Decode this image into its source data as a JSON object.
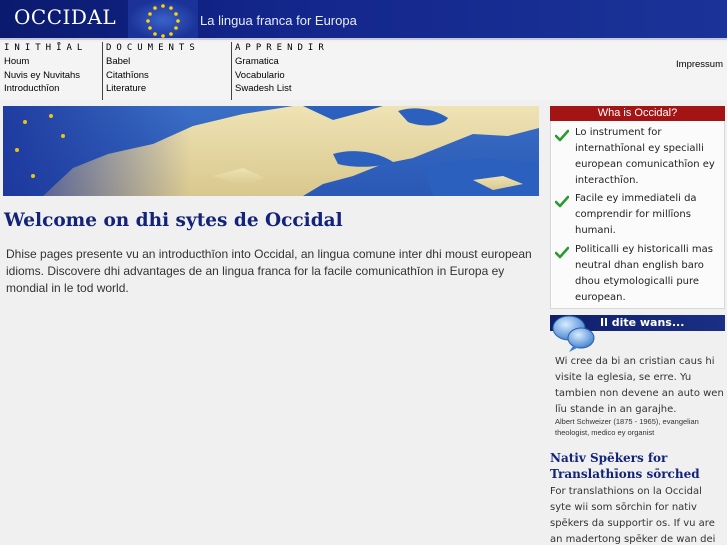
{
  "header": {
    "logo": "OCCIDAL",
    "tagline": "La lingua franca for Europa"
  },
  "nav": {
    "columns": [
      {
        "heading": "INITHĪAL",
        "links": [
          "Houm",
          "Nuvis ey Nuvitahs",
          "Introducthīon"
        ]
      },
      {
        "heading": "DOCUMENTS",
        "links": [
          "Babel",
          "Citathīons",
          "Literature"
        ]
      },
      {
        "heading": "APPRENDIR",
        "links": [
          "Gramatica",
          "Vocabulario",
          "Swadesh List"
        ]
      }
    ],
    "impressum": "Impressum"
  },
  "main": {
    "title": "Welcome on dhi sytes de Occidal",
    "intro": "Dhise pages presente vu an introducthīon into Occidal, an lingua comune inter dhi moust european idioms. Discovere dhi advantages de an lingua franca for la facile comunicathīon in Europa ey mondial in le tod world."
  },
  "sidebar": {
    "what_title": "Wha is Occidal?",
    "features": [
      "Lo instrument for internathīonal ey specialli european comunicathīon ey interacthīon.",
      "Facile ey immediateli da comprendir for millīons humani.",
      "Politicalli ey historicalli mas neutral dhan english baro dhou etymologicalli pure european."
    ],
    "quote_title": "Il dite wans...",
    "quote_text": "Wi cree da bi an cristian caus hi visite la eglesia, se erre. Yu tambien non devene an auto wen līu stande in an garajhe.",
    "quote_author": "Albert Schweizer (1875 - 1965), evangelian theologist, medico ey organist",
    "nativ_title": "Nativ Spēkers for Translathīons sōrched",
    "nativ_text": "For translathions on la Occidal syte wii som sōrchin for nativ spēkers da supportir os. If vu are an madertong spēker de wan dei"
  },
  "colors": {
    "header_bg": "#12258a",
    "title_blue": "#13237a",
    "box_red": "#a31515",
    "check_green": "#2e9a2e"
  },
  "icons": {
    "check": "check-icon",
    "speech": "speech-bubble-icon",
    "eu_flag": "eu-flag-icon"
  }
}
